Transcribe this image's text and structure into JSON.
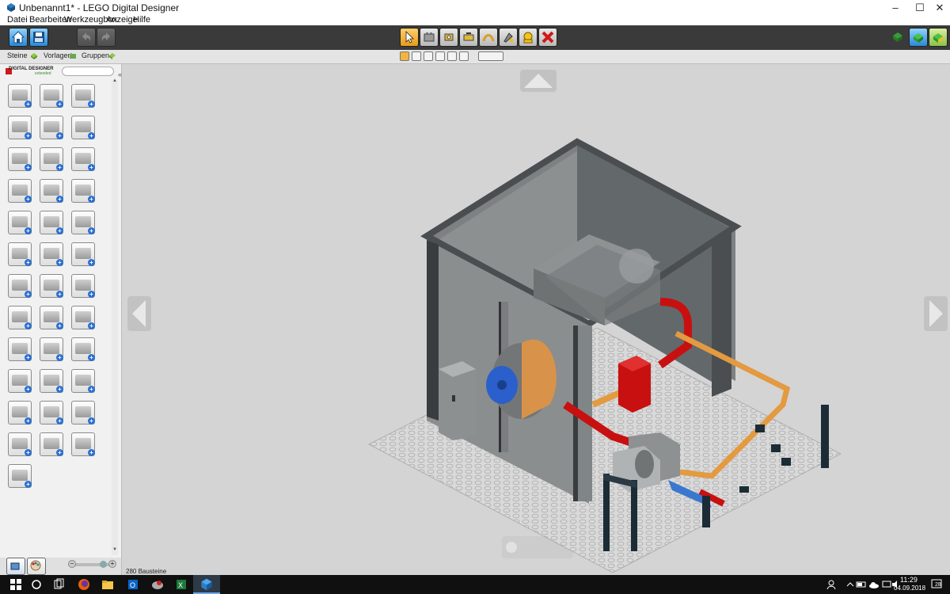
{
  "window": {
    "title": "Unbenannt1* - LEGO Digital Designer",
    "minimize_glyph": "–",
    "maximize_glyph": "☐",
    "close_glyph": "✕"
  },
  "menu": {
    "items": [
      "Datei",
      "Bearbeiten",
      "Werkzeugbox",
      "Anzeige",
      "Hilfe"
    ]
  },
  "toolbar": {
    "left_buttons": [
      "home-icon",
      "save-icon",
      "undo-icon",
      "redo-icon"
    ],
    "center_tools": [
      "select-tool-icon",
      "clone-tool-icon",
      "hinge-tool-icon",
      "hinge-align-tool-icon",
      "flex-tool-icon",
      "paint-tool-icon",
      "hide-tool-icon",
      "delete-tool-icon"
    ],
    "right_modes": [
      "build-mode-icon",
      "view-mode-icon",
      "building-guide-mode-icon"
    ],
    "accent_color": "#f0a020"
  },
  "palette_tabs": {
    "items": [
      {
        "label": "Steine",
        "icon": "bricks-tab-icon"
      },
      {
        "label": "Vorlagen",
        "icon": "templates-tab-icon"
      },
      {
        "label": "Gruppen",
        "icon": "groups-tab-icon"
      }
    ]
  },
  "panel": {
    "logo_text": "DIGITAL DESIGNER",
    "logo_sub": "extended",
    "search_placeholder": "",
    "collapse_glyph": "«",
    "brick_categories": [
      "brick-icon",
      "plate-with-hole-icon",
      "brick-slope-icon",
      "plate-icon",
      "slope-icon",
      "wedge-icon",
      "rounded-brick-icon",
      "tile-plate-icon",
      "plate-2x2-icon",
      "bracket-icon",
      "modified-plate-icon",
      "panel-door-icon",
      "tire-icon",
      "technic-brick-icon",
      "technic-beam-icon",
      "technic-liftarm-icon",
      "axle-icon",
      "gear-icon",
      "connector-icon",
      "cylinder-icon",
      "tile-icon",
      "tool-icon",
      "hose-icon",
      "chain-icon",
      "antenna-icon",
      "wheel-hub-icon",
      "panel-icon",
      "horn-icon",
      "minifigure-icon",
      "cone-icon",
      "dish-icon",
      "helmet-icon",
      "robot-icon",
      "barrel-icon",
      "hammer-icon",
      "headset-icon",
      "animal-icon"
    ]
  },
  "bottom_left": {
    "zoom_minus": "−",
    "zoom_plus": "+"
  },
  "status": {
    "brick_count": "280 Bausteine"
  },
  "taskbar": {
    "time": "11:29",
    "date": "04.09.2018",
    "notification_count": "28"
  }
}
